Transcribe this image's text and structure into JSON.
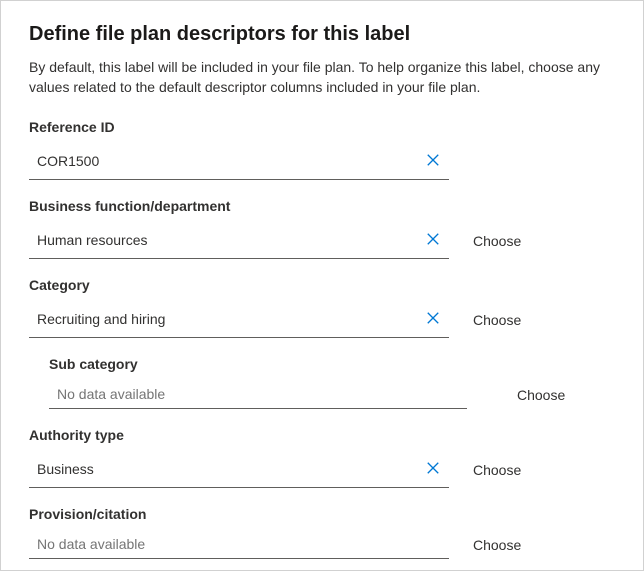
{
  "header": {
    "title": "Define file plan descriptors for this label",
    "description": "By default, this label will be included in your file plan. To help organize this label, choose any values related to the default descriptor columns included in your file plan."
  },
  "fields": {
    "reference_id": {
      "label": "Reference ID",
      "value": "COR1500"
    },
    "business_function": {
      "label": "Business function/department",
      "value": "Human resources",
      "choose": "Choose"
    },
    "category": {
      "label": "Category",
      "value": "Recruiting and hiring",
      "choose": "Choose"
    },
    "sub_category": {
      "label": "Sub category",
      "placeholder": "No data available",
      "choose": "Choose"
    },
    "authority_type": {
      "label": "Authority type",
      "value": "Business",
      "choose": "Choose"
    },
    "provision_citation": {
      "label": "Provision/citation",
      "placeholder": "No data available",
      "choose": "Choose"
    }
  }
}
